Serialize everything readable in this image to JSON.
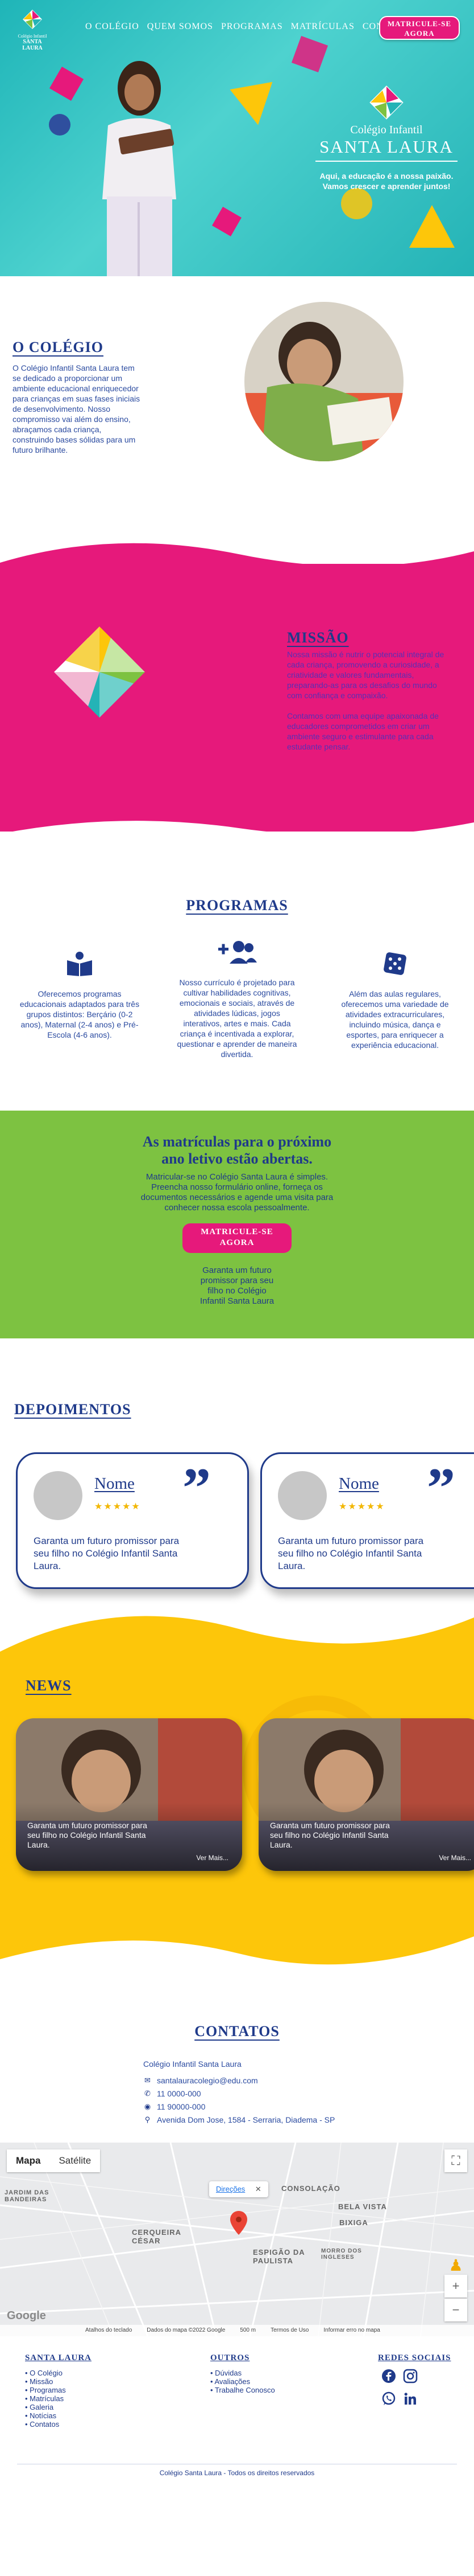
{
  "brand": {
    "logo_line1": "Colégio Infantil",
    "logo_line2": "SANTA LAURA"
  },
  "nav": {
    "items": [
      "O COLÉGIO",
      "QUEM SOMOS",
      "PROGRAMAS",
      "MATRÍCULAS",
      "CONTATO"
    ],
    "cta": "MATRICULE-SE AGORA"
  },
  "hero": {
    "subtitle": "Colégio Infantil",
    "title": "SANTA LAURA",
    "tagline": "Aqui, a educação é a nossa paixão. Vamos crescer e aprender juntos!"
  },
  "colegio": {
    "title": "O COLÉGIO",
    "text": "O Colégio Infantil Santa Laura tem se dedicado a proporcionar um ambiente educacional enriquecedor para crianças em suas fases iniciais de desenvolvimento. Nosso compromisso vai além do ensino, abraçamos cada criança, construindo bases sólidas para um futuro brilhante."
  },
  "missao": {
    "title": "MISSÃO",
    "text1": "Nossa missão é nutrir o potencial integral de cada criança, promovendo a curiosidade, a criatividade e valores fundamentais, preparando-as para os desafios do mundo com confiança e compaixão.",
    "text2": "Contamos com uma equipe apaixonada de educadores comprometidos em criar um ambiente seguro e estimulante para cada estudante pensar."
  },
  "programas": {
    "title": "PROGRAMAS",
    "items": [
      {
        "icon": "book-reader-icon",
        "text": "Oferecemos programas educacionais adaptados para três grupos distintos: Berçário (0-2 anos), Maternal (2-4 anos) e Pré-Escola (4-6 anos)."
      },
      {
        "icon": "users-plus-icon",
        "text": "Nosso currículo é projetado para cultivar habilidades cognitivas, emocionais e sociais, através de atividades lúdicas, jogos interativos, artes e mais. Cada criança é incentivada a explorar, questionar e aprender de maneira divertida."
      },
      {
        "icon": "dice-icon",
        "text": "Além das aulas regulares, oferecemos uma variedade de atividades extracurriculares, incluindo música, dança e esportes, para enriquecer a experiência educacional."
      }
    ]
  },
  "matriculas": {
    "title": "As matrículas para o próximo ano letivo estão abertas.",
    "text": "Matricular-se no Colégio Santa Laura é simples. Preencha nosso formulário online, forneça os documentos necessários e agende uma visita para conhecer nossa escola pessoalmente.",
    "cta": "MATRICULE-SE AGORA",
    "small": "Garanta um futuro promissor para seu filho no Colégio Infantil Santa Laura"
  },
  "depoimentos": {
    "title": "DEPOIMENTOS",
    "cards": [
      {
        "name": "Nome",
        "stars": "★★★★★",
        "avatar_label": "user",
        "text": "Garanta um futuro promissor para seu filho no Colégio Infantil Santa Laura."
      },
      {
        "name": "Nome",
        "stars": "★★★★★",
        "avatar_label": "user",
        "text": "Garanta um futuro promissor para seu filho no Colégio Infantil Santa Laura."
      }
    ]
  },
  "news": {
    "title": "NEWS",
    "cards": [
      {
        "text": "Garanta um futuro promissor para seu filho no Colégio Infantil Santa Laura.",
        "more": "Ver Mais..."
      },
      {
        "text": "Garanta um futuro promissor para seu filho no Colégio Infantil Santa Laura.",
        "more": "Ver Mais..."
      }
    ]
  },
  "contatos": {
    "title": "CONTATOS",
    "name": "Colégio Infantil Santa Laura",
    "email": "santalauracolegio@edu.com",
    "phone": "11 0000-000",
    "whatsapp": "11 90000-000",
    "address": "Avenida Dom Jose, 1584 - Serraria, Diadema - SP"
  },
  "map": {
    "tab_map": "Mapa",
    "tab_satellite": "Satélite",
    "pin_label": "Direções",
    "labels": [
      "CONSOLAÇÃO",
      "BELA VISTA",
      "BIXIGA",
      "JARDIM DAS BANDEIRAS",
      "CERQUEIRA CÉSAR",
      "ESPIGÃO DA PAULISTA",
      "MORRO DOS INGLESES"
    ],
    "google": "Google",
    "bottom": [
      "Atalhos do teclado",
      "Dados do mapa ©2022 Google",
      "500 m",
      "Termos de Uso",
      "Informar erro no mapa"
    ]
  },
  "footer": {
    "col1_title": "SANTA LAURA",
    "col1": [
      "O Colégio",
      "Missão",
      "Programas",
      "Matrículas",
      "Galeria",
      "Notícias",
      "Contatos"
    ],
    "col2_title": "OUTROS",
    "col2": [
      "Dúvidas",
      "Avaliações",
      "Trabalhe Conosco"
    ],
    "col3_title": "REDES SOCIAIS",
    "copyright": "Colégio Santa Laura - Todos os direitos reservados"
  },
  "colors": {
    "teal": "#24b3b6",
    "magenta": "#e6197b",
    "navy": "#1f3a8a",
    "green": "#7dc241",
    "yellow": "#fdc60a"
  }
}
